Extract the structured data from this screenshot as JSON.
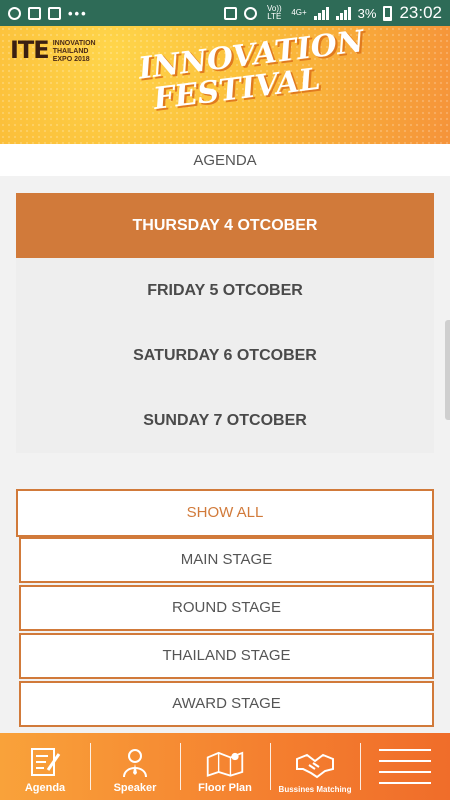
{
  "status_bar": {
    "network": "Vo)) LTE",
    "network_type": "4G+",
    "battery": "3%",
    "time": "23:02"
  },
  "banner": {
    "ite_brand": "ITE",
    "ite_line1": "INNOVATION",
    "ite_line2": "THAILAND",
    "ite_line3": "EXPO 2018",
    "title_line1": "INNOVATION",
    "title_line2": "FESTIVAL"
  },
  "header": {
    "title": "AGENDA"
  },
  "dates": [
    {
      "label": "THURSDAY 4 OTCOBER",
      "selected": true
    },
    {
      "label": "FRIDAY 5 OTCOBER",
      "selected": false
    },
    {
      "label": "SATURDAY 6 OTCOBER",
      "selected": false
    },
    {
      "label": "SUNDAY 7 OTCOBER",
      "selected": false
    }
  ],
  "stages": {
    "show_all": "SHOW ALL",
    "items": [
      "MAIN STAGE",
      "ROUND STAGE",
      "THAILAND STAGE",
      "AWARD STAGE"
    ]
  },
  "bottom_nav": {
    "items": [
      {
        "label": "Agenda",
        "icon": "agenda-icon"
      },
      {
        "label": "Speaker",
        "icon": "speaker-icon"
      },
      {
        "label": "Floor Plan",
        "icon": "floor-plan-icon"
      },
      {
        "label": "Bussines Matching",
        "icon": "handshake-icon"
      },
      {
        "label": "",
        "icon": "menu-icon"
      }
    ]
  },
  "colors": {
    "accent": "#d17a3a",
    "status_bar": "#2e6b57",
    "nav_gradient_start": "#f9a23a",
    "nav_gradient_end": "#f06d2a"
  }
}
